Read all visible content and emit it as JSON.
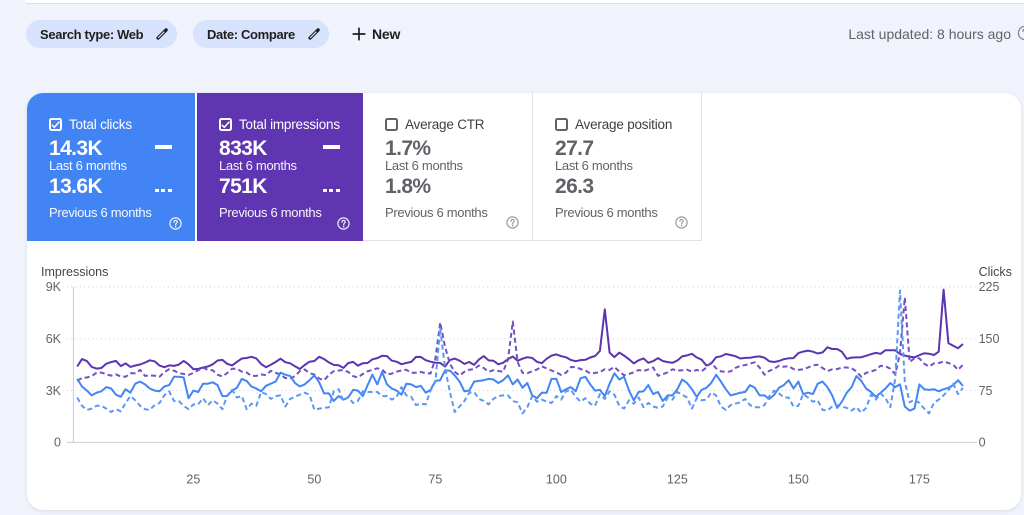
{
  "colors": {
    "background": "#f0f3fb",
    "chip_background": "#d7e2fc",
    "panel_background": "#ffffff",
    "clicks_accent": "#4284f4",
    "impressions_accent": "#5f35b1",
    "divider": "#dfe1e5"
  },
  "icons": {
    "chip_edit": "pencil-icon",
    "new_filter": "plus-icon",
    "help": "question-circle-icon",
    "metric_selected": "checked-checkbox-icon",
    "metric_unselected": "unchecked-checkbox-icon"
  },
  "header": {
    "chips": [
      {
        "label": "Search type: Web"
      },
      {
        "label": "Date: Compare"
      }
    ],
    "new_button_label": "New",
    "last_updated": "Last updated: 8 hours ago"
  },
  "cards": [
    {
      "label": "Total clicks",
      "checked": true,
      "current_value": "14.3K",
      "current_caption": "Last 6 months",
      "previous_value": "13.6K",
      "previous_caption": "Previous 6 months",
      "color": "#4284f4"
    },
    {
      "label": "Total impressions",
      "checked": true,
      "current_value": "833K",
      "current_caption": "Last 6 months",
      "previous_value": "751K",
      "previous_caption": "Previous 6 months",
      "color": "#5f35b1"
    },
    {
      "label": "Average CTR",
      "checked": false,
      "current_value": "1.7%",
      "current_caption": "Last 6 months",
      "previous_value": "1.8%",
      "previous_caption": "Previous 6 months",
      "color": "#ffffff"
    },
    {
      "label": "Average position",
      "checked": false,
      "current_value": "27.7",
      "current_caption": "Last 6 months",
      "previous_value": "26.3",
      "previous_caption": "Previous 6 months",
      "color": "#ffffff"
    }
  ],
  "chart_data": {
    "type": "line",
    "left_axis": {
      "title": "Impressions",
      "ticks": [
        "0",
        "3K",
        "6K",
        "9K"
      ],
      "max": 9000
    },
    "right_axis": {
      "title": "Clicks",
      "ticks": [
        "0",
        "75",
        "150",
        "225"
      ],
      "max": 225
    },
    "x_axis": {
      "ticks": [
        25,
        50,
        75,
        100,
        125,
        150,
        175
      ]
    },
    "series": [
      {
        "name": "Impressions - Last 6 months",
        "axis": "left",
        "style": "solid",
        "color": "#5b34b0",
        "values": [
          4400,
          4823,
          4711,
          4374,
          4273,
          4307,
          4551,
          4653,
          4722,
          4419,
          4574,
          4374,
          4453,
          4510,
          4622,
          4753,
          4699,
          4446,
          4358,
          4461,
          4431,
          4504,
          4721,
          4525,
          4241,
          4257,
          4338,
          4398,
          4521,
          4745,
          4778,
          4552,
          4458,
          4663,
          4860,
          4887,
          4959,
          4864,
          4539,
          4358,
          4500,
          4659,
          4847,
          4646,
          4580,
          4409,
          4249,
          4482,
          4674,
          4717,
          4955,
          4832,
          4635,
          4486,
          4468,
          4316,
          4592,
          4661,
          4442,
          4589,
          4599,
          4814,
          4884,
          5017,
          4998,
          4733,
          4675,
          4529,
          4597,
          4661,
          4950,
          4945,
          4762,
          4671,
          4618,
          4602,
          4393,
          4765,
          4851,
          4732,
          4544,
          4655,
          4488,
          4797,
          4998,
          4750,
          4734,
          4526,
          4611,
          4824,
          4974,
          4723,
          4848,
          4935,
          4887,
          4667,
          4585,
          4846,
          5026,
          5096,
          4995,
          4930,
          4774,
          4701,
          4766,
          4786,
          4919,
          5004,
          5300,
          7700,
          5200,
          4938,
          5199,
          5025,
          4815,
          4576,
          4756,
          4867,
          4609,
          4709,
          4880,
          4712,
          4653,
          4612,
          4744,
          4982,
          5037,
          5131,
          4922,
          4791,
          4454,
          4563,
          4936,
          4981,
          5122,
          5061,
          4990,
          4861,
          4891,
          4899,
          4952,
          4979,
          4903,
          4698,
          4655,
          4713,
          4819,
          4868,
          4884,
          5172,
          5257,
          5314,
          5250,
          5147,
          5212,
          5510,
          5412,
          5409,
          5245,
          4844,
          4912,
          4925,
          4932,
          5015,
          5109,
          5183,
          5131,
          5337,
          5340,
          5332,
          5120,
          5035,
          4954,
          4931,
          5055,
          5159,
          5136,
          5062,
          5250,
          8850,
          5750,
          5600,
          5450,
          5700
        ]
      },
      {
        "name": "Impressions - Previous 6 months",
        "axis": "left",
        "style": "dashed",
        "color": "#7550c4",
        "values": [
          3570,
          3732,
          3760,
          3842,
          4038,
          4040,
          3946,
          3867,
          3936,
          3818,
          3801,
          4004,
          4002,
          4198,
          3849,
          3872,
          3862,
          3801,
          4078,
          4235,
          4155,
          4017,
          3960,
          3903,
          4027,
          4176,
          4330,
          4198,
          4176,
          3923,
          3814,
          4021,
          4270,
          4270,
          4100,
          4049,
          3853,
          3853,
          3938,
          3893,
          4146,
          4035,
          3913,
          3729,
          3697,
          3847,
          4125,
          4226,
          4013,
          3928,
          3703,
          3595,
          3911,
          4130,
          4163,
          4191,
          4085,
          3837,
          3763,
          3964,
          4116,
          4199,
          4290,
          4222,
          3938,
          3987,
          4093,
          4171,
          4204,
          4031,
          4031,
          4084,
          4000,
          3989,
          4850,
          6950,
          5550,
          4550,
          4089,
          3877,
          4093,
          4212,
          4247,
          4451,
          4308,
          4090,
          4179,
          4136,
          4088,
          4800,
          7000,
          4650,
          4028,
          4000,
          4121,
          4221,
          4399,
          4288,
          4166,
          4055,
          3902,
          4037,
          4365,
          4356,
          4252,
          4164,
          3996,
          4024,
          4057,
          4239,
          4201,
          4373,
          4107,
          3887,
          3970,
          4061,
          4192,
          4137,
          4228,
          4335,
          3860,
          3950,
          4058,
          4233,
          4160,
          4183,
          4212,
          4101,
          4197,
          4115,
          4337,
          4623,
          4286,
          4112,
          4085,
          4113,
          4314,
          4432,
          4474,
          4562,
          4637,
          4333,
          3918,
          4149,
          4258,
          4440,
          4377,
          4419,
          4244,
          4200,
          4226,
          4337,
          4458,
          4500,
          4308,
          4127,
          4231,
          4246,
          4331,
          4338,
          4297,
          4109,
          3797,
          4028,
          4097,
          4202,
          4436,
          4414,
          4268,
          3946,
          5150,
          8400,
          4650,
          4880,
          4867,
          4565,
          4390,
          4573,
          4594,
          4694,
          4601,
          4490,
          4206,
          4500
        ]
      },
      {
        "name": "Clicks - Last 6 months",
        "axis": "right",
        "style": "solid",
        "color": "#4285f4",
        "values": [
          92,
          81,
          75,
          68,
          72,
          74,
          80,
          78,
          69,
          66,
          77,
          72,
          85,
          88,
          84,
          78,
          75,
          74,
          81,
          83,
          95,
          95,
          94,
          64,
          75,
          73,
          85,
          85,
          87,
          83,
          67,
          67,
          75,
          79,
          92,
          89,
          81,
          78,
          74,
          82,
          85,
          88,
          101,
          98,
          96,
          86,
          81,
          84,
          90,
          97,
          87,
          71,
          71,
          60,
          67,
          62,
          65,
          76,
          75,
          67,
          83,
          98,
          84,
          102,
          84,
          78,
          75,
          69,
          85,
          84,
          80,
          82,
          72,
          76,
          89,
          90,
          104,
          104,
          97,
          88,
          74,
          75,
          88,
          89,
          90,
          92,
          91,
          86,
          90,
          97,
          84,
          91,
          79,
          86,
          68,
          64,
          72,
          72,
          92,
          92,
          73,
          77,
          80,
          74,
          93,
          95,
          84,
          75,
          76,
          67,
          85,
          100,
          91,
          95,
          75,
          61,
          73,
          74,
          83,
          70,
          73,
          60,
          68,
          68,
          77,
          91,
          86,
          77,
          66,
          76,
          79,
          86,
          98,
          88,
          77,
          68,
          70,
          72,
          73,
          83,
          79,
          68,
          68,
          63,
          69,
          79,
          83,
          90,
          78,
          88,
          70,
          72,
          70,
          85,
          88,
          80,
          68,
          50,
          59,
          72,
          80,
          96,
          89,
          78,
          73,
          66,
          72,
          78,
          86,
          80,
          84,
          52,
          46,
          49,
          84,
          77,
          76,
          77,
          74,
          77,
          79,
          83,
          90,
          82
        ]
      },
      {
        "name": "Clicks - Previous 6 months",
        "axis": "right",
        "style": "dashed",
        "color": "#5d97f5",
        "values": [
          65,
          53,
          47,
          49,
          53,
          53,
          49,
          44,
          48,
          45,
          57,
          67,
          61,
          53,
          48,
          47,
          54,
          57,
          68,
          74,
          60,
          60,
          53,
          48,
          55,
          55,
          64,
          54,
          61,
          56,
          48,
          68,
          76,
          65,
          67,
          48,
          56,
          53,
          73,
          70,
          63,
          67,
          68,
          52,
          63,
          66,
          69,
          72,
          69,
          47,
          49,
          50,
          51,
          74,
          77,
          60,
          66,
          57,
          60,
          74,
          73,
          73,
          73,
          67,
          67,
          62,
          66,
          80,
          68,
          66,
          54,
          56,
          55,
          75,
          88,
          165,
          108,
          73,
          44,
          52,
          60,
          72,
          73,
          63,
          60,
          55,
          63,
          67,
          68,
          68,
          60,
          58,
          42,
          51,
          67,
          59,
          62,
          59,
          57,
          67,
          62,
          74,
          76,
          66,
          59,
          64,
          56,
          53,
          70,
          63,
          74,
          69,
          53,
          49,
          61,
          56,
          65,
          51,
          57,
          52,
          50,
          52,
          65,
          62,
          73,
          69,
          65,
          49,
          64,
          61,
          62,
          72,
          68,
          52,
          47,
          54,
          56,
          58,
          63,
          54,
          51,
          51,
          54,
          67,
          75,
          71,
          65,
          65,
          52,
          53,
          70,
          65,
          59,
          61,
          47,
          46,
          52,
          54,
          52,
          50,
          46,
          51,
          43,
          50,
          69,
          62,
          71,
          64,
          51,
          92,
          220,
          88,
          58,
          62,
          57,
          49,
          42,
          57,
          62,
          68,
          76,
          85,
          70,
          79
        ]
      }
    ]
  }
}
